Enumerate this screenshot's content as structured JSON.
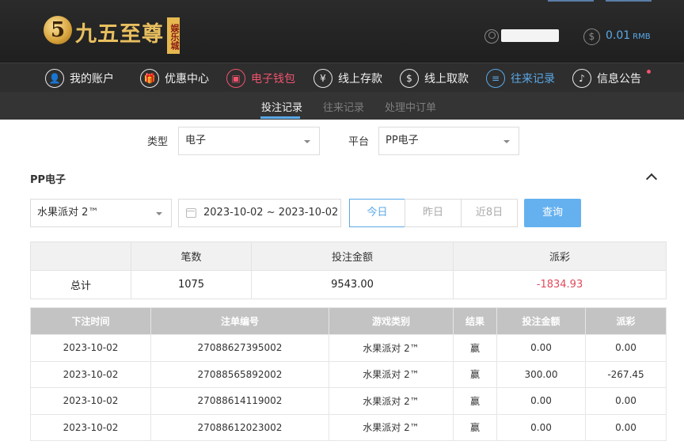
{
  "brand": {
    "logo_mark": "5",
    "name": "九五至尊",
    "tag": "娱乐城"
  },
  "account": {
    "balance": "0.01",
    "currency": "RMB"
  },
  "main_nav": [
    {
      "label": "我的账户",
      "icon": "user-icon",
      "state": "normal"
    },
    {
      "label": "优惠中心",
      "icon": "gift-icon",
      "state": "normal"
    },
    {
      "label": "电子钱包",
      "icon": "wallet-icon",
      "state": "highlight"
    },
    {
      "label": "线上存款",
      "icon": "deposit-icon",
      "state": "normal"
    },
    {
      "label": "线上取款",
      "icon": "withdraw-icon",
      "state": "normal"
    },
    {
      "label": "往来记录",
      "icon": "record-icon",
      "state": "active"
    },
    {
      "label": "信息公告",
      "icon": "bell-icon",
      "state": "normal"
    }
  ],
  "sub_nav": {
    "tabs": [
      "投注记录",
      "往来记录",
      "处理中订单"
    ],
    "active_index": 0
  },
  "filters": {
    "type_label": "类型",
    "type_value": "电子",
    "platform_label": "平台",
    "platform_value": "PP电子"
  },
  "section": {
    "title": "PP电子"
  },
  "search": {
    "game_value": "水果派对 2™",
    "date_range": "2023-10-02 ~ 2023-10-02",
    "quick_ranges": [
      "今日",
      "昨日",
      "近8日"
    ],
    "active_range_index": 0,
    "query_label": "查询"
  },
  "summary": {
    "headers": [
      "",
      "笔数",
      "投注金额",
      "派彩"
    ],
    "row_label": "总计",
    "count": "1075",
    "bet_amount": "9543.00",
    "payout": "-1834.93"
  },
  "records": {
    "headers": [
      "下注时间",
      "注单编号",
      "游戏类别",
      "结果",
      "投注金额",
      "派彩"
    ],
    "rows": [
      {
        "time": "2023-10-02",
        "id": "27088627395002",
        "game": "水果派对 2™",
        "result": "赢",
        "bet": "0.00",
        "payout": "0.00",
        "negative": false
      },
      {
        "time": "2023-10-02",
        "id": "27088565892002",
        "game": "水果派对 2™",
        "result": "赢",
        "bet": "300.00",
        "payout": "-267.45",
        "negative": true
      },
      {
        "time": "2023-10-02",
        "id": "27088614119002",
        "game": "水果派对 2™",
        "result": "赢",
        "bet": "0.00",
        "payout": "0.00",
        "negative": false
      },
      {
        "time": "2023-10-02",
        "id": "27088612023002",
        "game": "水果派对 2™",
        "result": "赢",
        "bet": "0.00",
        "payout": "0.00",
        "negative": false
      }
    ]
  },
  "colors": {
    "accent_blue": "#5aa9e8",
    "accent_red": "#f0536e",
    "gold": "#e8bf5f"
  }
}
